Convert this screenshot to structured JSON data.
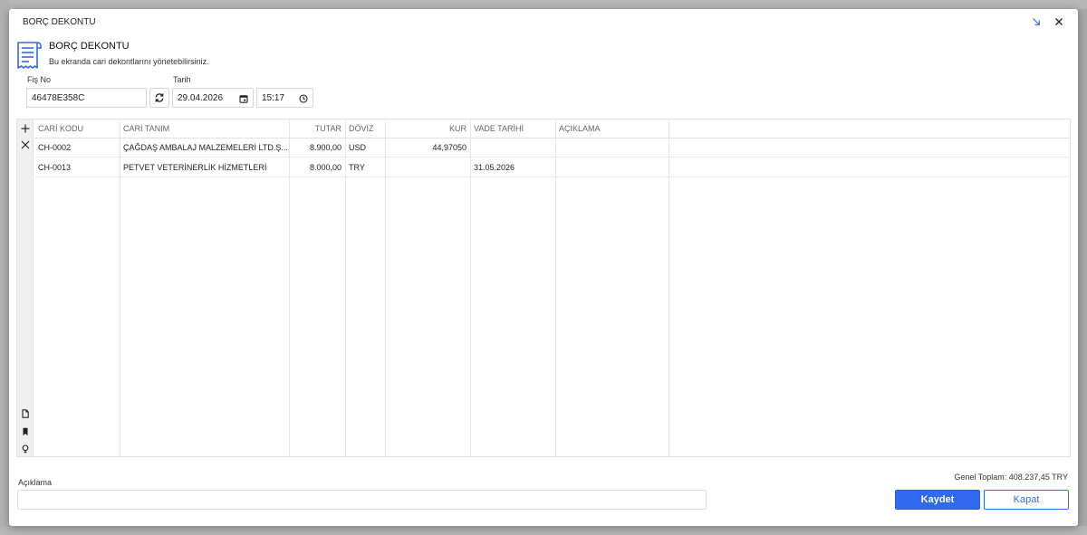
{
  "window": {
    "title": "BORÇ DEKONTU"
  },
  "header": {
    "title": "BORÇ DEKONTU",
    "subtitle": "Bu ekranda cari dekontlarını yönetebilirsiniz."
  },
  "form": {
    "fis_no_label": "Fiş No",
    "fis_no_value": "46478E358C",
    "tarih_label": "Tarih",
    "date_value": "29.04.2026",
    "time_value": "15:17"
  },
  "grid": {
    "columns": [
      "CARİ KODU",
      "CARİ TANIM",
      "TUTAR",
      "DÖVİZ",
      "KUR",
      "VADE TARİHİ",
      "AÇIKLAMA"
    ],
    "rows": [
      [
        "CH-0002",
        "ÇAĞDAŞ AMBALAJ MALZEMELERİ LTD.Ş...",
        "8.900,00",
        "USD",
        "44,97050",
        "",
        ""
      ],
      [
        "CH-0013",
        "PETVET VETERİNERLİK HİZMETLERİ",
        "8.000,00",
        "TRY",
        "",
        "31.05.2026",
        ""
      ]
    ]
  },
  "footer": {
    "aciklama_label": "Açıklama",
    "total": "Genel Toplam: 408.237,45 TRY",
    "save_label": "Kaydet",
    "close_label": "Kapat"
  },
  "colors": {
    "primary": "#2f6af1",
    "icon_blue": "#2f6af1"
  },
  "icons": [
    "minimize-arrow-icon",
    "close-icon",
    "receipt-icon",
    "refresh-icon",
    "calendar-icon",
    "clock-icon",
    "plus-icon",
    "delete-icon",
    "document-icon",
    "bookmark-icon",
    "lightbulb-icon"
  ]
}
